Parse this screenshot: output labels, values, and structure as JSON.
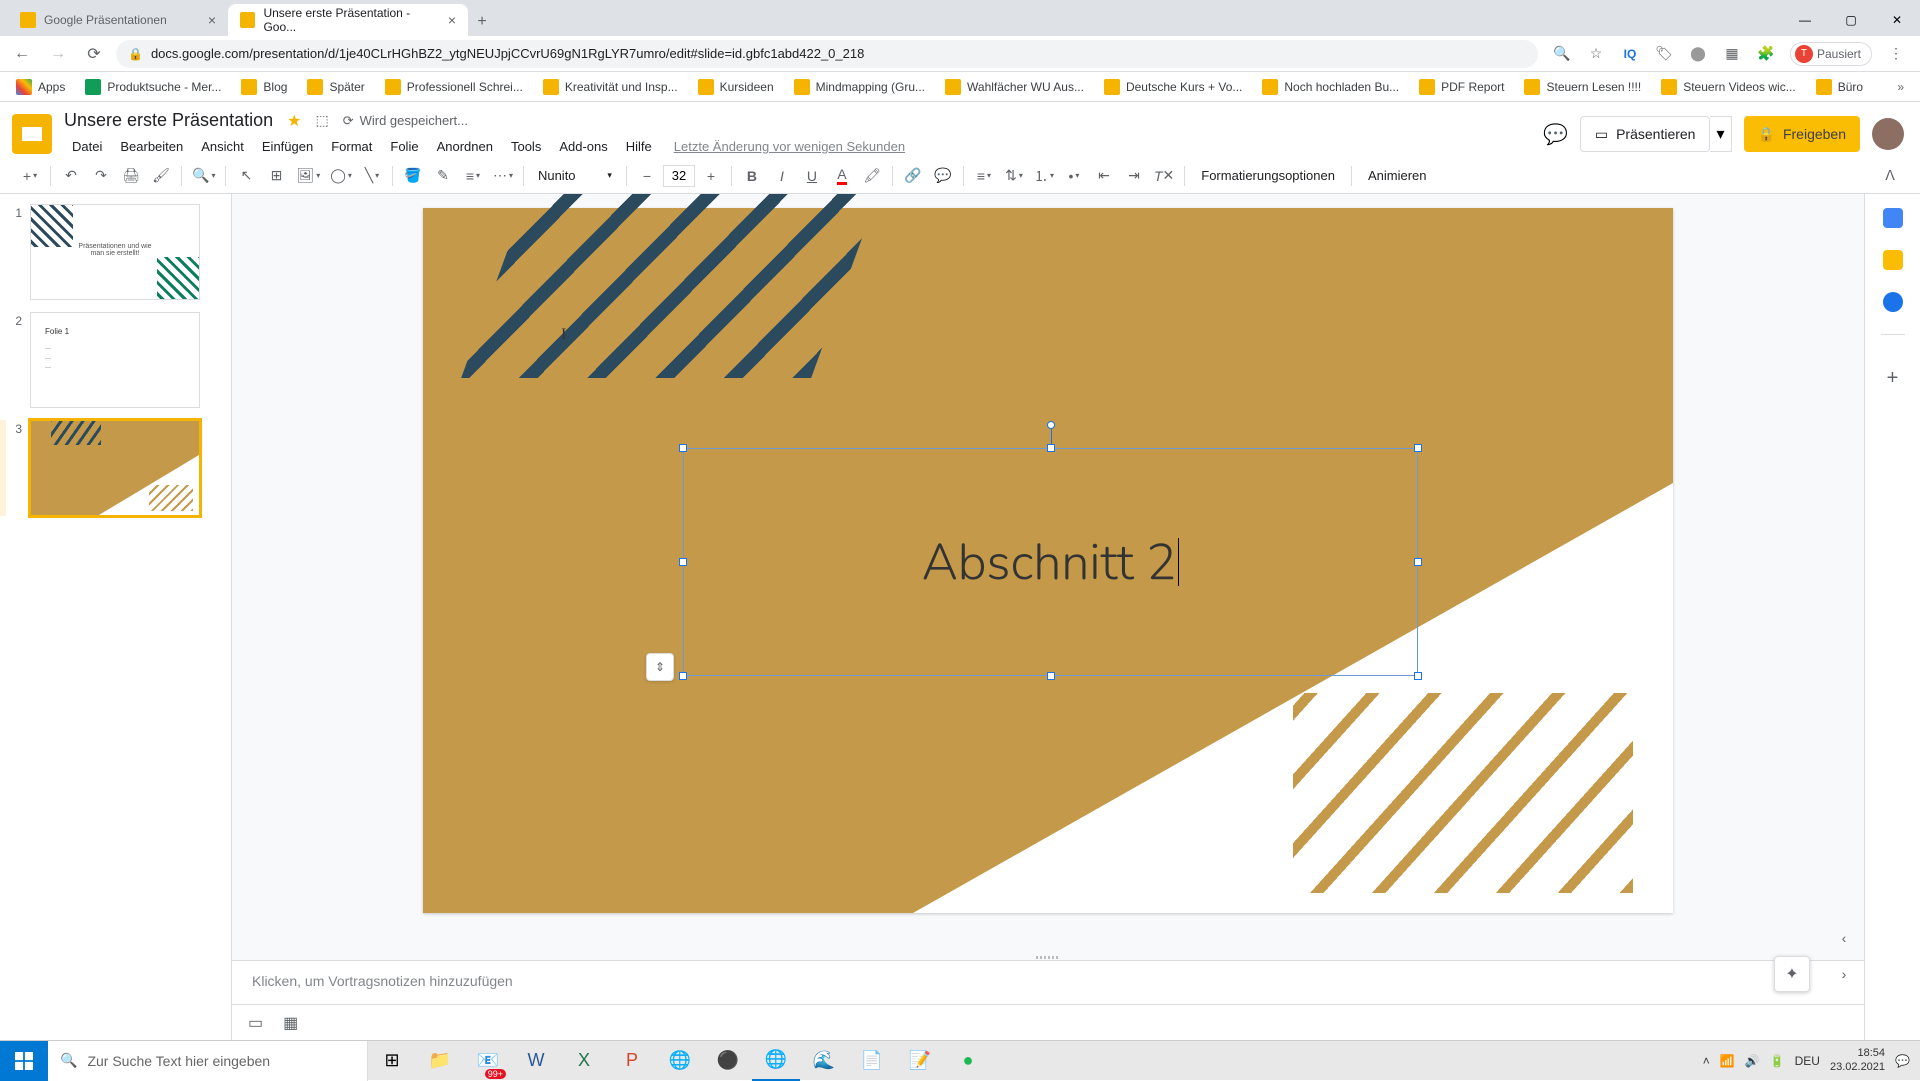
{
  "browser": {
    "tabs": [
      {
        "title": "Google Präsentationen"
      },
      {
        "title": "Unsere erste Präsentation - Goo..."
      }
    ],
    "url": "docs.google.com/presentation/d/1je40CLrHGhBZ2_ytgNEUJpjCCvrU69gN1RgLYR7umro/edit#slide=id.gbfc1abd422_0_218",
    "profile_status": "Pausiert",
    "bookmarks": [
      "Apps",
      "Produktsuche - Mer...",
      "Blog",
      "Später",
      "Professionell Schrei...",
      "Kreativität und Insp...",
      "Kursideen",
      "Mindmapping (Gru...",
      "Wahlfächer WU Aus...",
      "Deutsche Kurs + Vo...",
      "Noch hochladen Bu...",
      "PDF Report",
      "Steuern Lesen !!!!",
      "Steuern Videos wic...",
      "Büro"
    ]
  },
  "app": {
    "doc_title": "Unsere erste Präsentation",
    "save_status": "Wird gespeichert...",
    "menus": [
      "Datei",
      "Bearbeiten",
      "Ansicht",
      "Einfügen",
      "Format",
      "Folie",
      "Anordnen",
      "Tools",
      "Add-ons",
      "Hilfe"
    ],
    "last_edit": "Letzte Änderung vor wenigen Sekunden",
    "present_label": "Präsentieren",
    "share_label": "Freigeben"
  },
  "toolbar": {
    "font_name": "Nunito",
    "font_size": "32",
    "format_options": "Formatierungsoptionen",
    "animate": "Animieren"
  },
  "slides": {
    "thumb1_text": "Präsentationen und wie\nman sie erstellt!",
    "thumb2_title": "Folie 1",
    "current_text": "Abschnitt 2"
  },
  "notes_placeholder": "Klicken, um Vortragsnotizen hinzuzufügen",
  "taskbar": {
    "search_placeholder": "Zur Suche Text hier eingeben",
    "notif_count": "99+",
    "lang": "DEU",
    "time": "18:54",
    "date": "23.02.2021"
  }
}
